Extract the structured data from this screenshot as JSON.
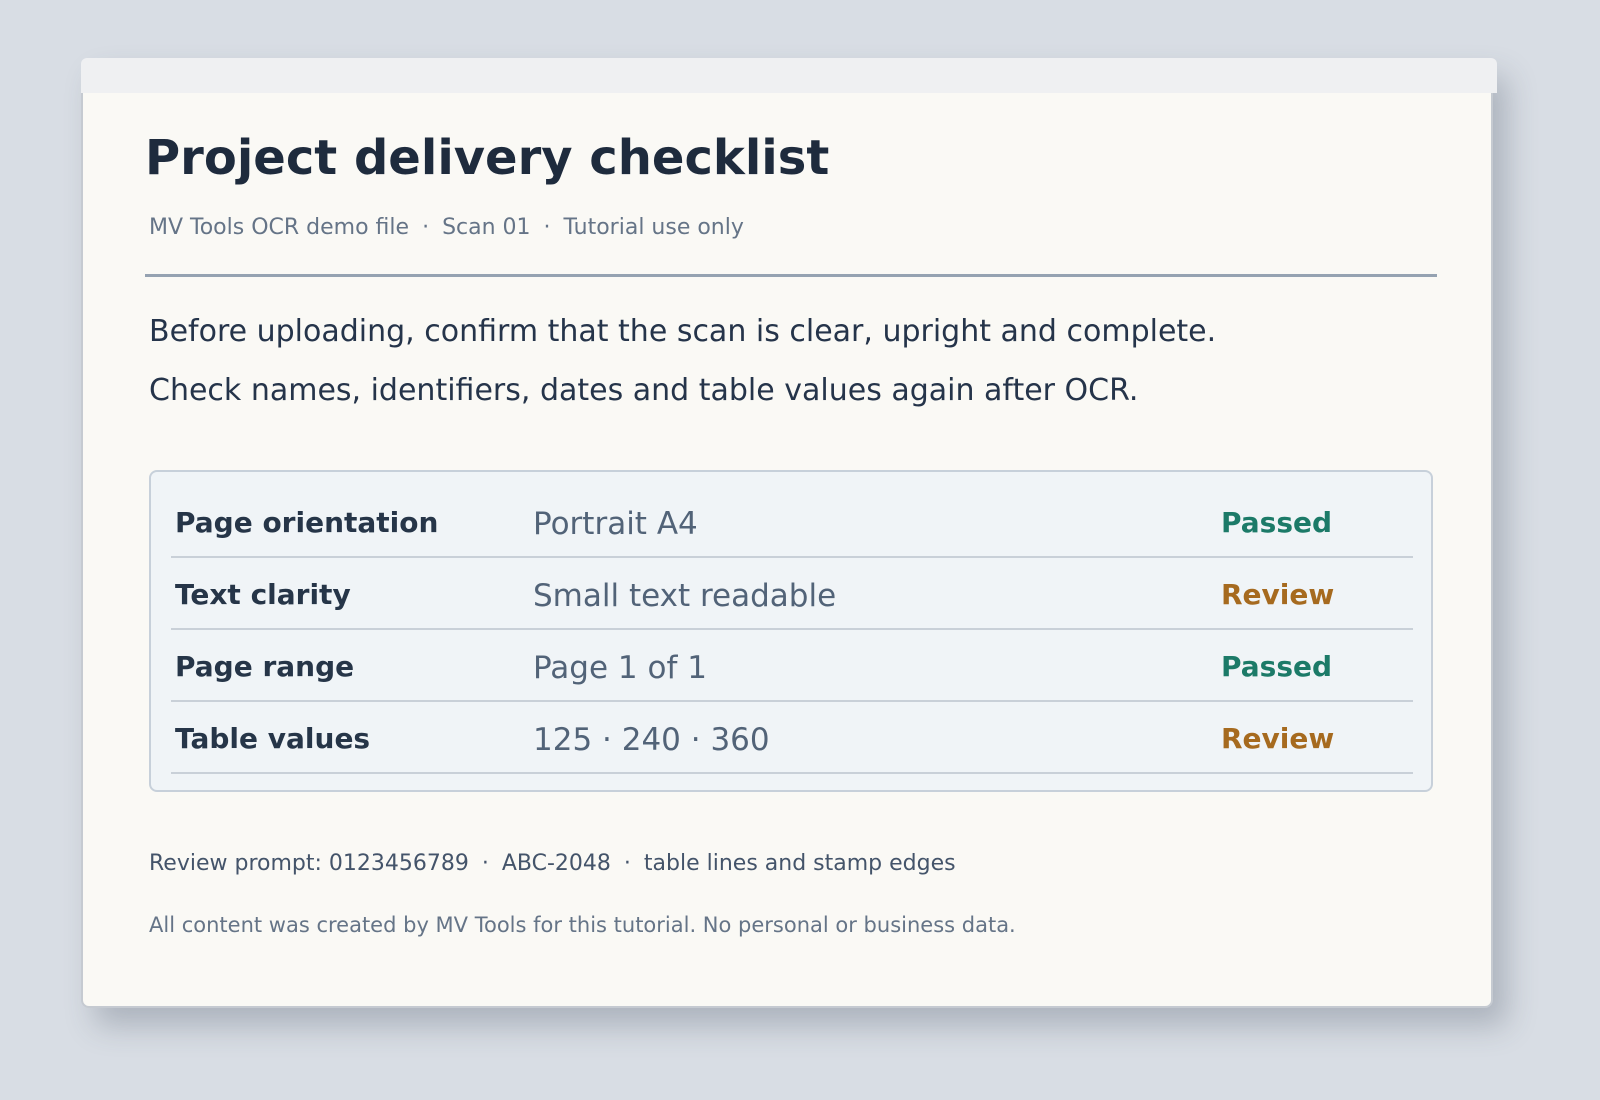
{
  "document": {
    "title": "Project delivery checklist",
    "meta": {
      "parts": [
        "MV Tools OCR demo file",
        "Scan 01",
        "Tutorial use only"
      ],
      "separator": "·"
    },
    "intro": [
      "Before uploading, confirm that the scan is clear, upright and complete.",
      "Check names, identifiers, dates and table values again after OCR."
    ],
    "checklist": [
      {
        "label": "Page orientation",
        "value": "Portrait A4",
        "status": "Passed"
      },
      {
        "label": "Text clarity",
        "value": "Small text readable",
        "status": "Review"
      },
      {
        "label": "Page range",
        "value": "Page 1 of 1",
        "status": "Passed"
      },
      {
        "label": "Table values",
        "value": "125 · 240 · 360",
        "status": "Review"
      }
    ],
    "review_prompt": {
      "parts": [
        "Review prompt: 0123456789",
        "ABC-2048",
        "table lines and stamp edges"
      ],
      "separator": "·"
    },
    "disclaimer": "All content was created by MV Tools for this tutorial. No personal or business data."
  },
  "colors": {
    "page_background": "#d8dde4",
    "paper": "#faf9f5",
    "title": "#1e2b3d",
    "status_passed": "#1c7a68",
    "status_review": "#a66a1f"
  }
}
